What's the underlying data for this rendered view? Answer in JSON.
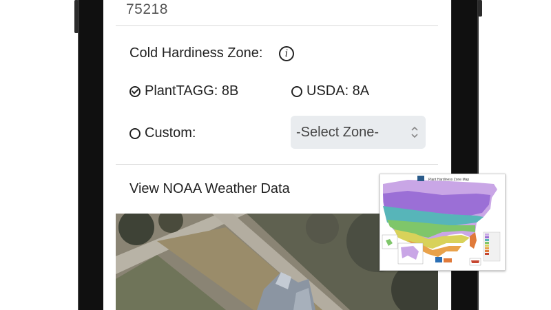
{
  "zip": {
    "value": "75218"
  },
  "hardiness": {
    "heading": "Cold Hardiness Zone:",
    "info_icon": "info-icon",
    "options": [
      {
        "label": "PlantTAGG: 8B",
        "selected": true
      },
      {
        "label": "USDA: 8A",
        "selected": false
      },
      {
        "label": "Custom:",
        "selected": false
      }
    ],
    "select": {
      "value": "-Select Zone-"
    }
  },
  "weather": {
    "link": "View NOAA Weather Data"
  },
  "map_thumb": {
    "title": "Plant Hardiness Zone Map"
  },
  "colors": {
    "frame": "#101010",
    "select_bg": "#e9ecef",
    "text": "#222222"
  }
}
